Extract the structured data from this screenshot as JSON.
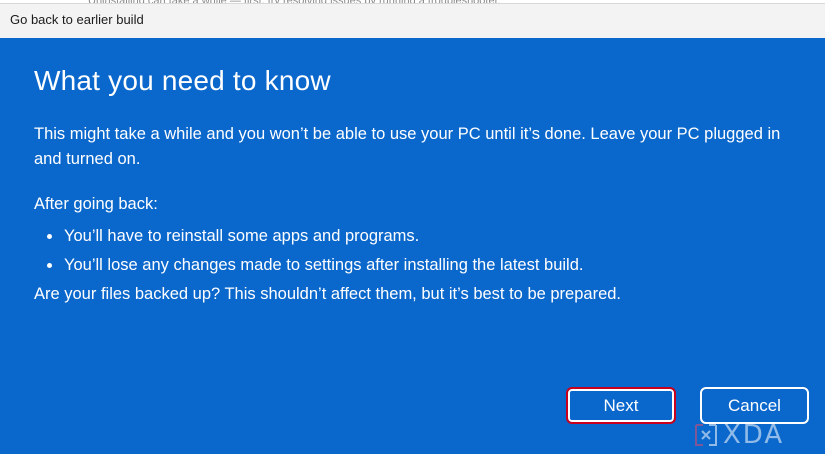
{
  "window": {
    "title": "Go back to earlier build",
    "background_sliver_text": "Uninstalling can take a while — first, try resolving issues by running a troubleshooter."
  },
  "colors": {
    "content_bg": "#0a67cc",
    "titlebar_bg": "#f3f3f3",
    "text": "#ffffff",
    "focus_ring": "#c8001e"
  },
  "main": {
    "heading": "What you need to know",
    "intro": "This might take a while and you won’t be able to use your PC until it’s done. Leave your PC plugged in and turned on.",
    "after_label": "After going back:",
    "bullets": [
      "You’ll have to reinstall some apps and programs.",
      "You’ll lose any changes made to settings after installing the latest build."
    ],
    "question": "Are your files backed up? This shouldn’t affect them, but it’s best to be prepared."
  },
  "buttons": {
    "next_label": "Next",
    "cancel_label": "Cancel"
  },
  "watermark": {
    "text": "XDA",
    "icon": "xda-logo-icon"
  }
}
